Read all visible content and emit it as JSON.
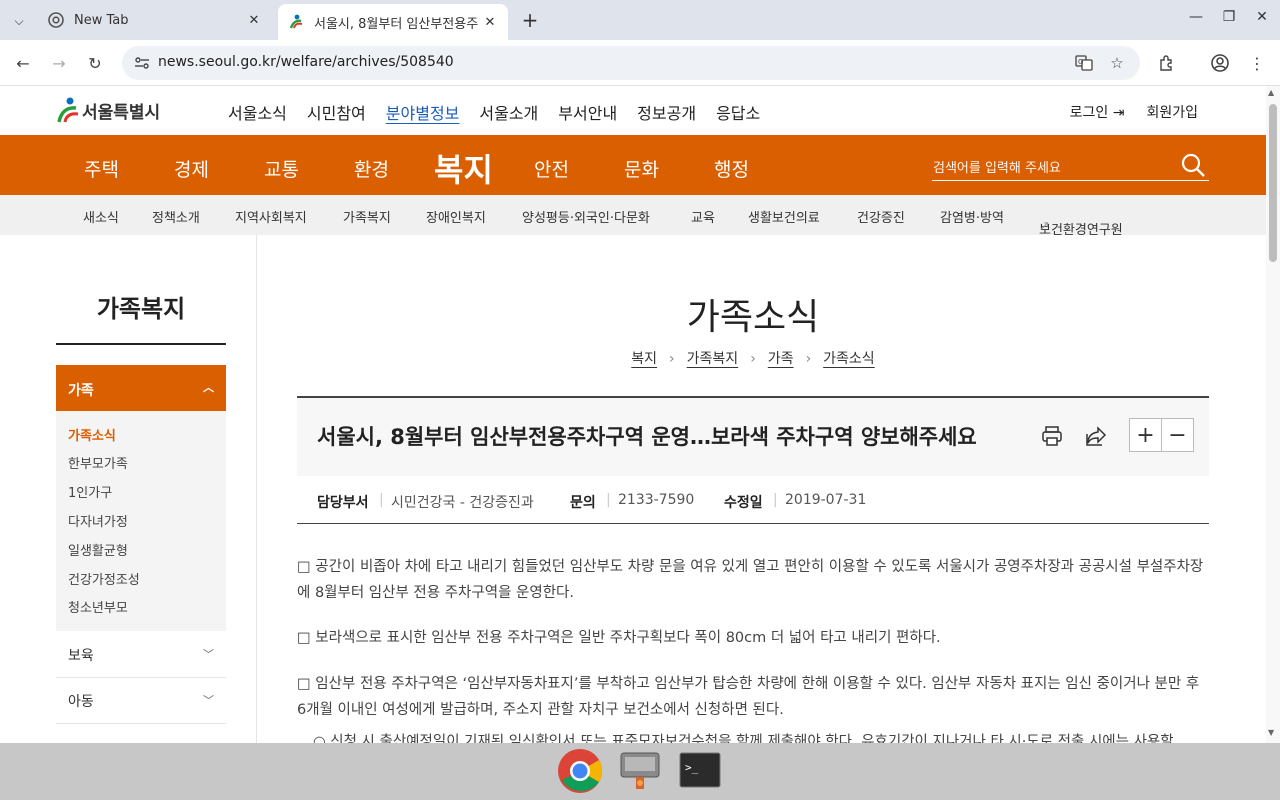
{
  "browser": {
    "tabs": [
      {
        "title": "New Tab"
      },
      {
        "title": "서울시, 8월부터 임산부전용주"
      }
    ],
    "url": "news.seoul.go.kr/welfare/archives/508540"
  },
  "site": {
    "logo_text": "서울특별시",
    "gnb": [
      "서울소식",
      "시민참여",
      "분야별정보",
      "서울소개",
      "부서안내",
      "정보공개",
      "응답소"
    ],
    "login": "로그인",
    "join": "회원가입",
    "categories": [
      "주택",
      "경제",
      "교통",
      "환경",
      "복지",
      "안전",
      "문화",
      "행정"
    ],
    "search_placeholder": "검색어를 입력해 주세요",
    "subnav": [
      "새소식",
      "정책소개",
      "지역사회복지",
      "가족복지",
      "장애인복지",
      "양성평등·외국인·다문화",
      "교육",
      "생활보건의료",
      "건강증진",
      "감염병·방역",
      "보건환경연구원"
    ]
  },
  "sidebar": {
    "title": "가족복지",
    "active_group": "가족",
    "sub_items": [
      "가족소식",
      "한부모가족",
      "1인가구",
      "다자녀가정",
      "일생활균형",
      "건강가정조성",
      "청소년부모"
    ],
    "groups": [
      "보육",
      "아동"
    ]
  },
  "main": {
    "page_title": "가족소식",
    "breadcrumb": [
      "복지",
      "가족복지",
      "가족",
      "가족소식"
    ],
    "article_title": "서울시, 8월부터 임산부전용주차구역 운영…보라색 주차구역 양보해주세요",
    "meta": {
      "dept_label": "담당부서",
      "dept_value": "시민건강국 - 건강증진과",
      "contact_label": "문의",
      "contact_value": "2133-7590",
      "date_label": "수정일",
      "date_value": "2019-07-31"
    },
    "paragraphs": [
      "□ 공간이 비좁아 차에 타고 내리기 힘들었던 임산부도 차량 문을 여유 있게 열고 편안히 이용할 수 있도록 서울시가 공영주차장과 공공시설 부설주차장에 8월부터 임산부 전용 주차구역을 운영한다.",
      "□ 보라색으로 표시한 임산부 전용 주차구역은 일반 주차구획보다 폭이 80cm 더 넓어 타고 내리기 편하다.",
      "□ 임산부 전용 주차구역은 ‘임산부자동차표지’를 부착하고 임산부가 탑승한 차량에 한해 이용할 수 있다. 임산부 자동차 표지는 임신 중이거나 분만 후 6개월 이내인 여성에게 발급하며, 주소지 관할 자치구 보건소에서 신청하면 된다.",
      "○ 신청 시 출산예정일이 기재된 임신확인서 또는 표준모자보건수첩을 함께 제출해야 한다. 유효기간이 지나거나 타 시·도로 전출 시에는 사용할"
    ]
  },
  "colors": {
    "accent": "#d95f00",
    "link_active": "#1a5dbf"
  }
}
